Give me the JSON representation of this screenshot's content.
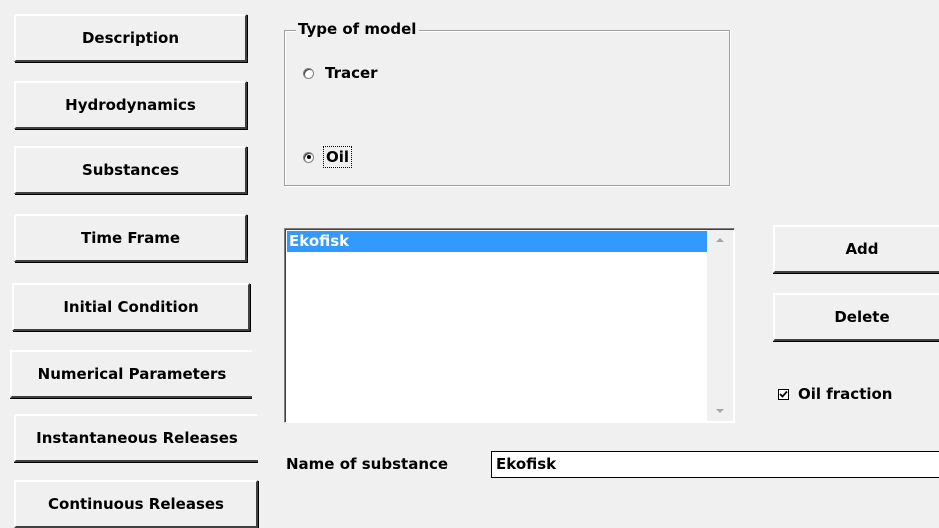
{
  "nav": {
    "description": "Description",
    "hydrodynamics": "Hydrodynamics",
    "substances": "Substances",
    "time_frame": "Time Frame",
    "initial_condition": "Initial Condition",
    "numerical_parameters": "Numerical Parameters",
    "instantaneous_releases": "Instantaneous Releases",
    "continuous_releases": "Continuous Releases"
  },
  "model_type": {
    "title": "Type of model",
    "options": [
      {
        "label": "Tracer",
        "selected": false
      },
      {
        "label": "Oil",
        "selected": true
      }
    ]
  },
  "substances_list": {
    "items": [
      "Ekofisk"
    ],
    "selected_index": 0
  },
  "actions": {
    "add_label": "Add",
    "delete_label": "Delete"
  },
  "oil_fraction": {
    "label": "Oil fraction",
    "checked": true
  },
  "name_field": {
    "label": "Name of substance",
    "value": "Ekofisk"
  },
  "colors": {
    "selection": "#3399ff",
    "background": "#f0f0f0"
  }
}
